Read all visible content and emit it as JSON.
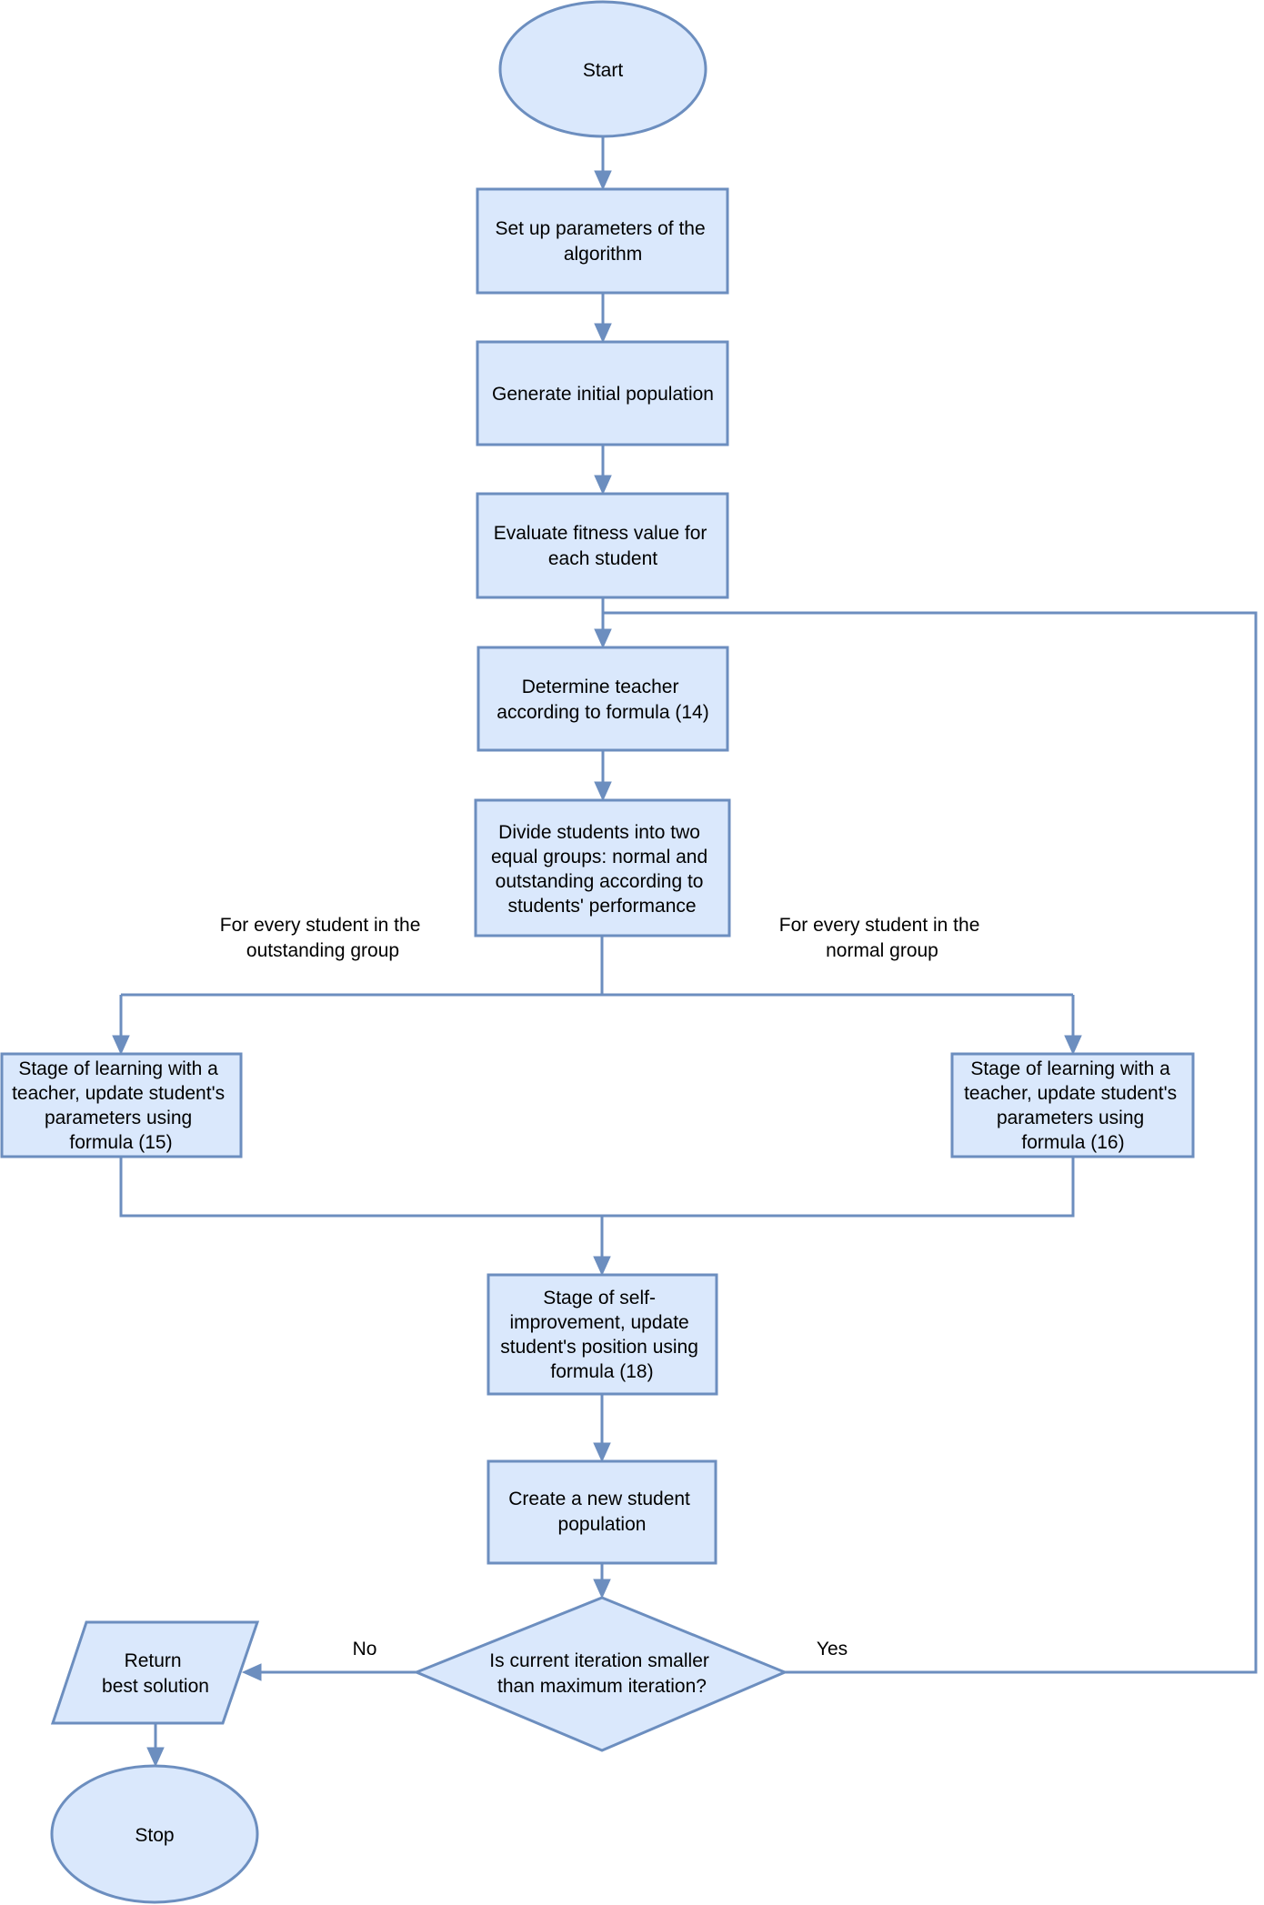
{
  "diagram": {
    "type": "flowchart",
    "colors": {
      "fill": "#dae8fc",
      "stroke": "#6c8ebf",
      "text": "#000000"
    },
    "nodes": {
      "start": {
        "shape": "ellipse",
        "lines": [
          "Start"
        ]
      },
      "setup": {
        "shape": "rectangle",
        "lines": [
          "Set up parameters of the",
          "algorithm"
        ]
      },
      "generate": {
        "shape": "rectangle",
        "lines": [
          "Generate initial population"
        ]
      },
      "evaluate": {
        "shape": "rectangle",
        "lines": [
          "Evaluate fitness value for",
          "each student"
        ]
      },
      "determine": {
        "shape": "rectangle",
        "lines": [
          "Determine teacher",
          "according to formula (14)"
        ]
      },
      "divide": {
        "shape": "rectangle",
        "lines": [
          "Divide students into two",
          "equal groups: normal and",
          "outstanding according to",
          "students' performance"
        ]
      },
      "stage_outstanding": {
        "shape": "rectangle",
        "lines": [
          "Stage of learning with a",
          "teacher, update student's",
          "parameters using",
          "formula (15)"
        ]
      },
      "stage_normal": {
        "shape": "rectangle",
        "lines": [
          "Stage of learning with a",
          "teacher, update student's",
          "parameters using",
          "formula (16)"
        ]
      },
      "self_improve": {
        "shape": "rectangle",
        "lines": [
          "Stage of self-",
          "improvement, update",
          "student's position using",
          "formula (18)"
        ]
      },
      "new_population": {
        "shape": "rectangle",
        "lines": [
          "Create a new student",
          "population"
        ]
      },
      "decision": {
        "shape": "diamond",
        "lines": [
          "Is current iteration smaller",
          "than maximum iteration?"
        ]
      },
      "return": {
        "shape": "parallelogram",
        "lines": [
          "Return",
          "best solution"
        ]
      },
      "stop": {
        "shape": "ellipse",
        "lines": [
          "Stop"
        ]
      }
    },
    "edge_labels": {
      "outstanding_branch": [
        "For every student in the",
        "outstanding group"
      ],
      "normal_branch": [
        "For every student in the",
        "normal group"
      ],
      "no": "No",
      "yes": "Yes"
    },
    "edges": [
      {
        "from": "start",
        "to": "setup"
      },
      {
        "from": "setup",
        "to": "generate"
      },
      {
        "from": "generate",
        "to": "evaluate"
      },
      {
        "from": "evaluate",
        "to": "determine"
      },
      {
        "from": "determine",
        "to": "divide"
      },
      {
        "from": "divide",
        "to": "stage_outstanding",
        "label": "outstanding_branch"
      },
      {
        "from": "divide",
        "to": "stage_normal",
        "label": "normal_branch"
      },
      {
        "from": "stage_outstanding",
        "to": "self_improve"
      },
      {
        "from": "stage_normal",
        "to": "self_improve"
      },
      {
        "from": "self_improve",
        "to": "new_population"
      },
      {
        "from": "new_population",
        "to": "decision"
      },
      {
        "from": "decision",
        "to": "return",
        "label": "no"
      },
      {
        "from": "decision",
        "to": "determine",
        "label": "yes"
      },
      {
        "from": "return",
        "to": "stop"
      }
    ]
  }
}
